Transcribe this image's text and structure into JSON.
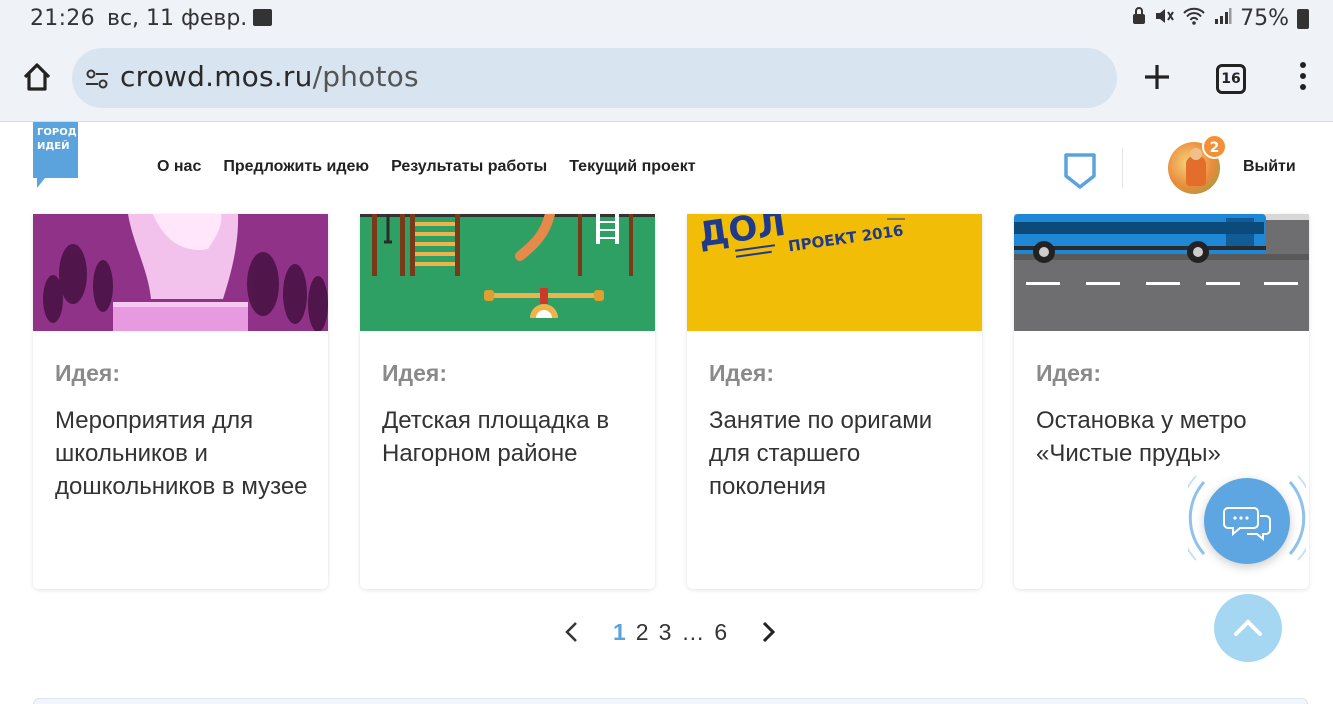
{
  "status_bar": {
    "time": "21:26",
    "date": "вс, 11 февр.",
    "battery": "75%"
  },
  "browser": {
    "url_host": "crowd.mos.ru",
    "url_path": "/photos",
    "tab_count": "16"
  },
  "site": {
    "logo_line1": "ГОРОД",
    "logo_line2": "ИДЕЙ",
    "nav": [
      "О нас",
      "Предложить идею",
      "Результаты работы",
      "Текущий проект"
    ],
    "notification_count": "2",
    "logout_label": "Выйти"
  },
  "cards": [
    {
      "label": "Идея:",
      "title": "Мероприятия для школьников и дошкольников в музее"
    },
    {
      "label": "Идея:",
      "title": "Детская площадка в Нагорном районе"
    },
    {
      "label": "Идея:",
      "title": "Занятие по оригами для старшего поколения",
      "image_text": "ПРОЕКТ 2016"
    },
    {
      "label": "Идея:",
      "title": "Остановка у метро «Чистые пруды»"
    }
  ],
  "pagination": {
    "pages": [
      "1",
      "2",
      "3",
      "…",
      "6"
    ],
    "current": "1"
  },
  "colors": {
    "accent": "#5ba3dc",
    "chat_button": "#5ea6e2",
    "up_button": "#a5d7f2",
    "badge": "#f2903a",
    "logo": "#5ba3dc"
  }
}
